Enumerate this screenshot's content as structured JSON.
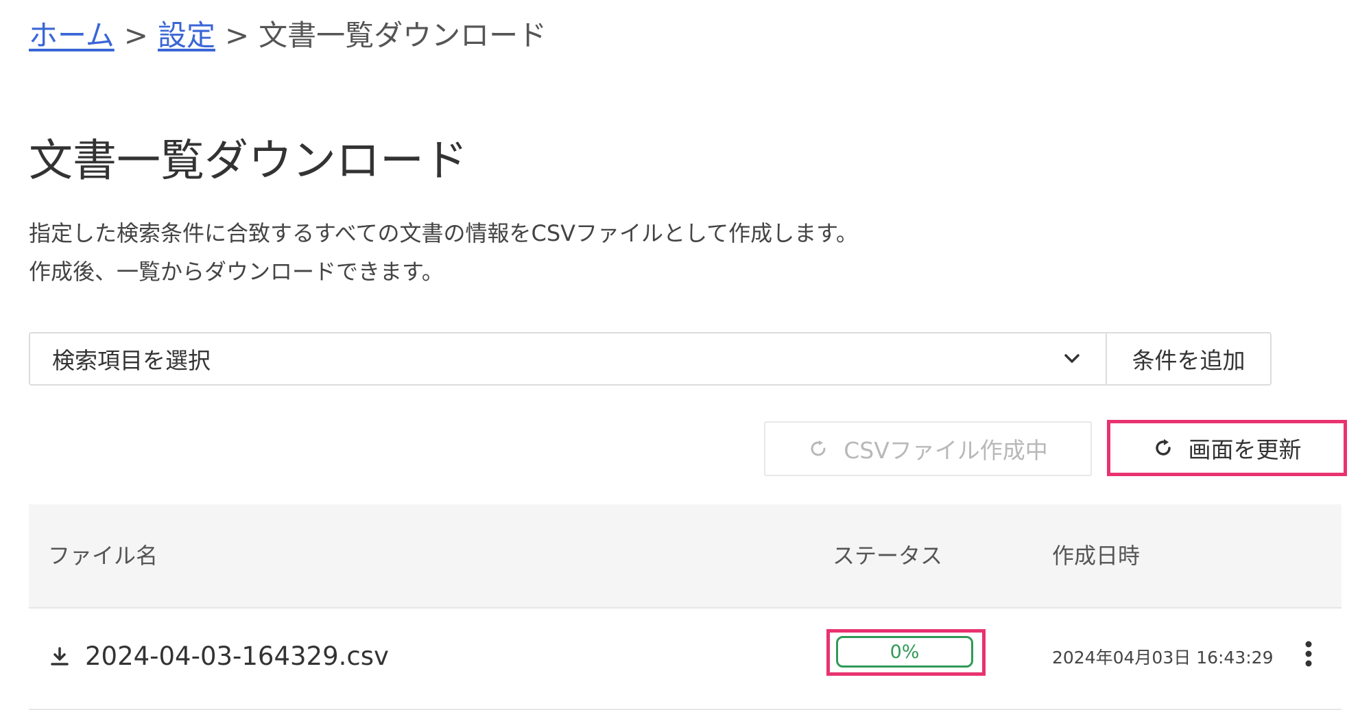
{
  "breadcrumb": {
    "home": "ホーム",
    "separator": ">",
    "settings": "設定",
    "current": "文書一覧ダウンロード"
  },
  "page": {
    "title": "文書一覧ダウンロード",
    "description_line1": "指定した検索条件に合致するすべての文書の情報をCSVファイルとして作成します。",
    "description_line2": "作成後、一覧からダウンロードできます。"
  },
  "search": {
    "select_label": "検索項目を選択",
    "select_icon": "chevron-down-icon",
    "add_button": "条件を追加"
  },
  "actions": {
    "csv_button": "CSVファイル作成中",
    "csv_icon": "spinner-icon",
    "refresh_button": "画面を更新",
    "refresh_icon": "refresh-icon"
  },
  "table": {
    "columns": [
      "ファイル名",
      "ステータス",
      "作成日時"
    ],
    "rows": [
      {
        "filename": "2024-04-03-164329.csv",
        "file_icon": "download-icon",
        "status": "0%",
        "progress": 0,
        "created": "2024年04月03日 16:43:29",
        "menu_icon": "more-vertical-icon"
      }
    ]
  },
  "colors": {
    "link": "#3a66d6",
    "highlight": "#e8336f",
    "progress": "#2f9a56",
    "header_bg": "#f6f5f5"
  }
}
